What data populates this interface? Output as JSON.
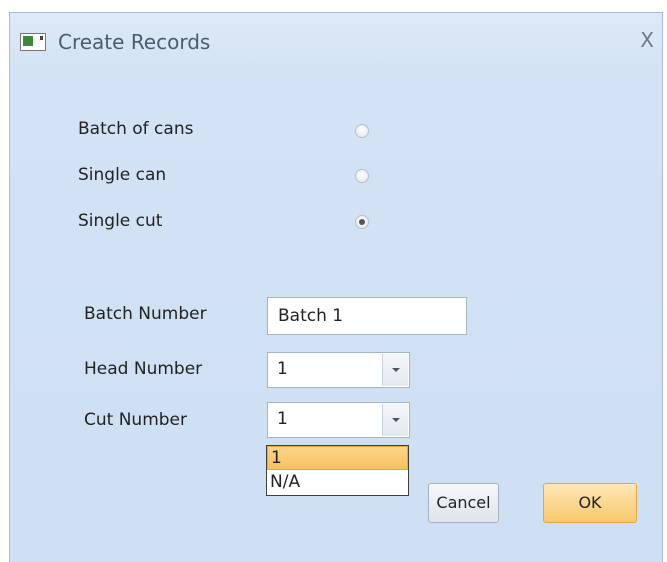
{
  "window": {
    "title": "Create Records",
    "close_label": "X"
  },
  "record_type": {
    "options": [
      {
        "label": "Batch of cans",
        "checked": false
      },
      {
        "label": "Single can",
        "checked": false
      },
      {
        "label": "Single cut",
        "checked": true
      }
    ]
  },
  "fields": {
    "batch_number": {
      "label": "Batch Number",
      "value": "Batch 1"
    },
    "head_number": {
      "label": "Head Number",
      "value": "1"
    },
    "cut_number": {
      "label": "Cut Number",
      "value": "1",
      "options": [
        "1",
        "N/A"
      ],
      "highlighted_option": "1"
    }
  },
  "buttons": {
    "cancel_label": "Cancel",
    "ok_label": "OK"
  }
}
